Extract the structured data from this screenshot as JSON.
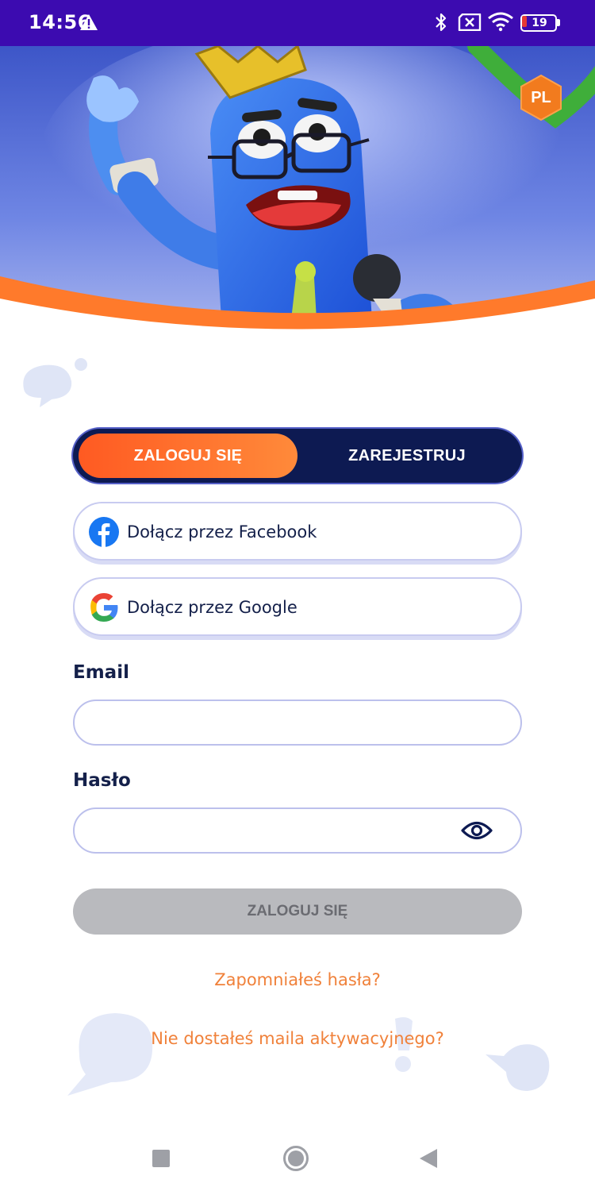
{
  "status_bar": {
    "time": "14:56",
    "battery_level": "19",
    "icons": [
      "warning-icon",
      "bluetooth-icon",
      "sim-disabled-icon",
      "wifi-icon",
      "battery-icon"
    ]
  },
  "hero": {
    "language_badge": "PL",
    "accent_color": "#ff7a2b"
  },
  "auth_tabs": {
    "login_label": "ZALOGUJ SIĘ",
    "register_label": "ZAREJESTRUJ",
    "active": "login"
  },
  "social": {
    "facebook_label": "Dołącz przez Facebook",
    "google_label": "Dołącz przez Google"
  },
  "form": {
    "email_label": "Email",
    "email_value": "",
    "password_label": "Hasło",
    "password_value": "",
    "submit_label": "ZALOGUJ SIĘ"
  },
  "links": {
    "forgot_password": "Zapomniałeś hasła?",
    "no_activation_mail": "Nie dostałeś maila aktywacyjnego?"
  },
  "colors": {
    "status_bar": "#3c0bb0",
    "tab_bg": "#0d1a52",
    "tab_active": "#ff6a2b",
    "link": "#f0813a",
    "submit_disabled": "#b9babe"
  }
}
